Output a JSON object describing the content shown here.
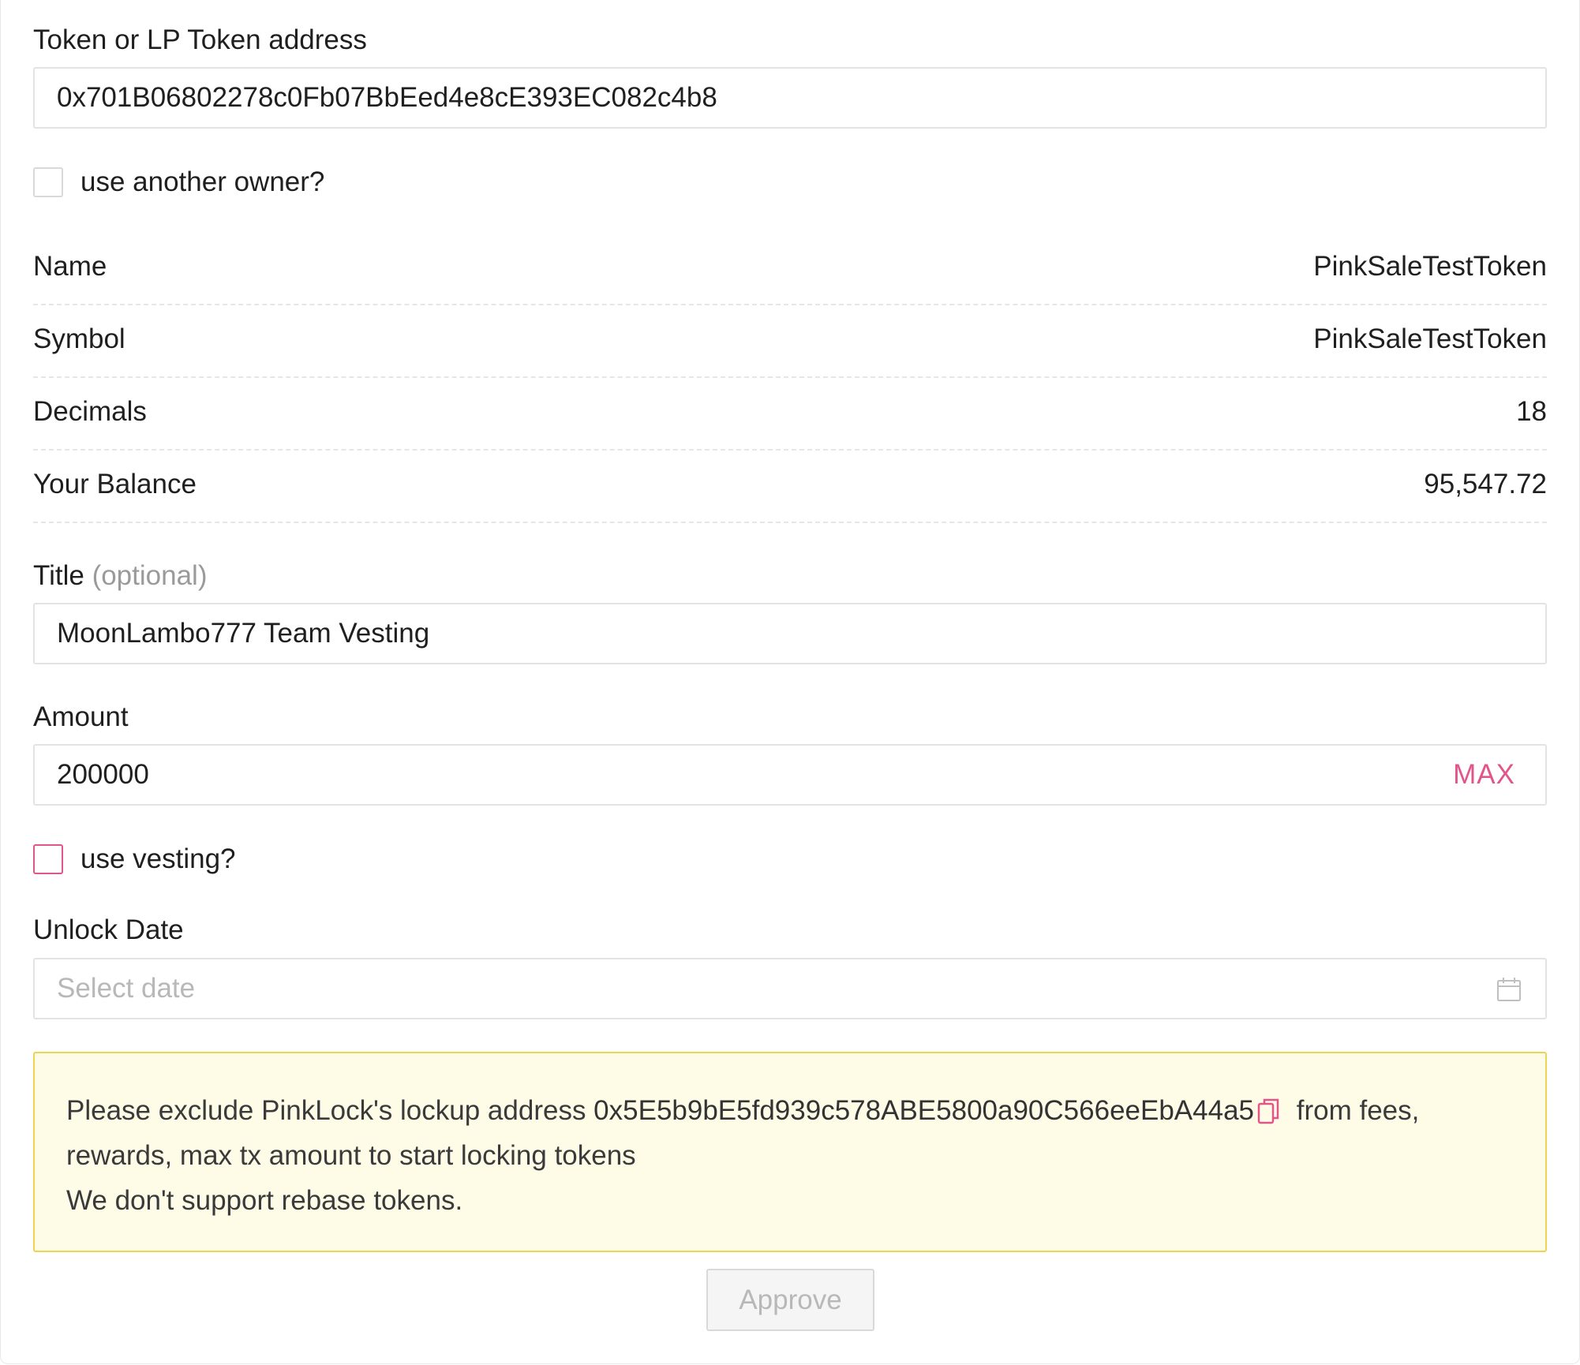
{
  "token_address": {
    "label": "Token or LP Token address",
    "value": "0x701B06802278c0Fb07BbEed4e8cE393EC082c4b8"
  },
  "another_owner": {
    "label": "use another owner?",
    "checked": false
  },
  "token_info": {
    "name_label": "Name",
    "name_value": "PinkSaleTestToken",
    "symbol_label": "Symbol",
    "symbol_value": "PinkSaleTestToken",
    "decimals_label": "Decimals",
    "decimals_value": "18",
    "balance_label": "Your Balance",
    "balance_value": "95,547.72"
  },
  "title_field": {
    "label": "Title",
    "optional_hint": "(optional)",
    "value": "MoonLambo777 Team Vesting"
  },
  "amount_field": {
    "label": "Amount",
    "value": "200000",
    "max_label": "MAX"
  },
  "vesting": {
    "label": "use vesting?",
    "checked": false
  },
  "unlock_date": {
    "label": "Unlock Date",
    "placeholder": "Select date"
  },
  "notice": {
    "text_before": "Please exclude PinkLock's lockup address ",
    "address": "0x5E5b9bE5fd939c578ABE5800a90C566eeEbA44a5",
    "text_after": " from fees, rewards, max tx amount to start locking tokens",
    "line2": "We don't support rebase tokens."
  },
  "approve_button": {
    "label": "Approve",
    "disabled": true
  },
  "colors": {
    "accent": "#e2558a",
    "notice_bg": "#fefbe6",
    "notice_border": "#ecd553"
  },
  "icons": {
    "calendar": "calendar-icon",
    "copy": "copy-icon"
  }
}
